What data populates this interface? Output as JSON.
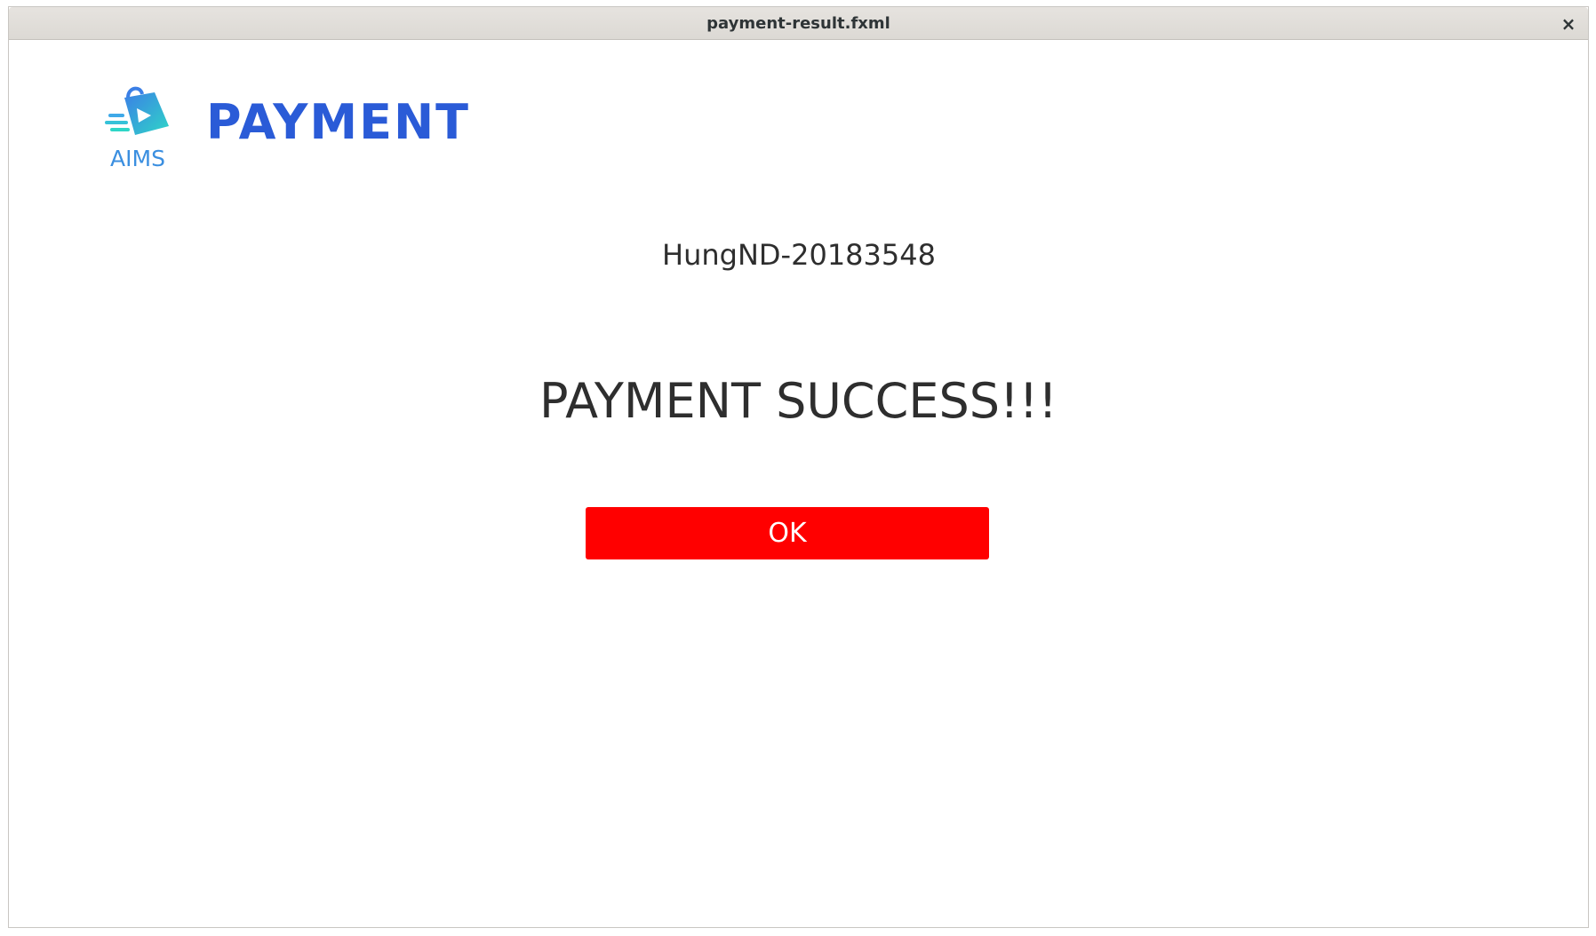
{
  "window": {
    "title": "payment-result.fxml",
    "close_glyph": "×"
  },
  "header": {
    "logo_text": "AIMS",
    "logo_icon": "shopping-bag-arrow-icon",
    "title": "PAYMENT"
  },
  "main": {
    "user_id": "HungND-20183548",
    "result_message": "PAYMENT SUCCESS!!!",
    "ok_label": "OK"
  },
  "colors": {
    "title_blue": "#2a5bd7",
    "logo_blue": "#3b8fe0",
    "button_red": "#ff0000",
    "text_dark": "#2e2e2e"
  }
}
